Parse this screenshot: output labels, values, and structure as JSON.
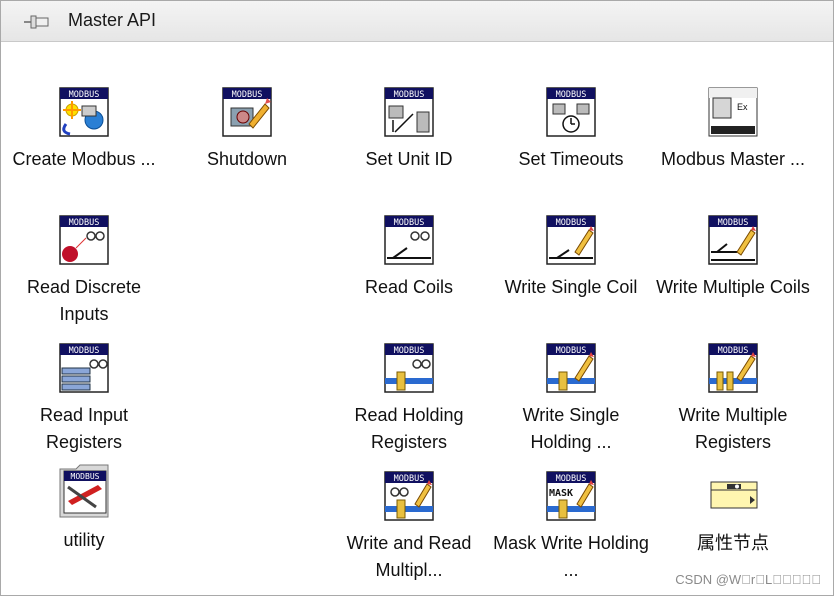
{
  "palette": {
    "title": "Master API",
    "items": [
      {
        "id": "create-modbus",
        "label": "Create Modbus ...",
        "icon": "modbus-create-icon"
      },
      {
        "id": "shutdown",
        "label": "Shutdown",
        "icon": "modbus-shutdown-icon"
      },
      {
        "id": "set-unit-id",
        "label": "Set Unit ID",
        "icon": "modbus-set-unit-id-icon"
      },
      {
        "id": "set-timeouts",
        "label": "Set Timeouts",
        "icon": "modbus-set-timeouts-icon"
      },
      {
        "id": "modbus-master",
        "label": "Modbus Master ...",
        "icon": "modbus-master-example-icon"
      },
      {
        "id": "read-discrete-inputs",
        "label": "Read Discrete Inputs",
        "icon": "modbus-read-discrete-icon"
      },
      {
        "id": "read-coils",
        "label": "Read Coils",
        "icon": "modbus-read-coils-icon"
      },
      {
        "id": "write-single-coil",
        "label": "Write Single Coil",
        "icon": "modbus-write-single-coil-icon"
      },
      {
        "id": "write-multiple-coils",
        "label": "Write Multiple Coils",
        "icon": "modbus-write-multiple-coils-icon"
      },
      {
        "id": "read-input-registers",
        "label": "Read Input Registers",
        "icon": "modbus-read-input-registers-icon"
      },
      {
        "id": "read-holding-registers",
        "label": "Read Holding Registers",
        "icon": "modbus-read-holding-icon"
      },
      {
        "id": "write-single-holding",
        "label": "Write Single Holding ...",
        "icon": "modbus-write-single-holding-icon"
      },
      {
        "id": "write-multiple-registers",
        "label": "Write Multiple Registers",
        "icon": "modbus-write-multiple-registers-icon"
      },
      {
        "id": "utility",
        "label": "utility",
        "icon": "modbus-utility-folder-icon"
      },
      {
        "id": "write-and-read-multiple",
        "label": "Write and Read Multipl...",
        "icon": "modbus-write-read-multiple-icon"
      },
      {
        "id": "mask-write-holding",
        "label": "Mask Write Holding ...",
        "icon": "modbus-mask-write-icon"
      },
      {
        "id": "property-node",
        "label": "属性节点",
        "icon": "property-node-icon"
      }
    ]
  },
  "watermark": "CSDN @W\u0000r\u0000L\u0000\u0000\u0000\u0000\u0000",
  "icon_text": {
    "modbus": "MODBUS",
    "mask": "MASK",
    "ex": "Ex"
  }
}
